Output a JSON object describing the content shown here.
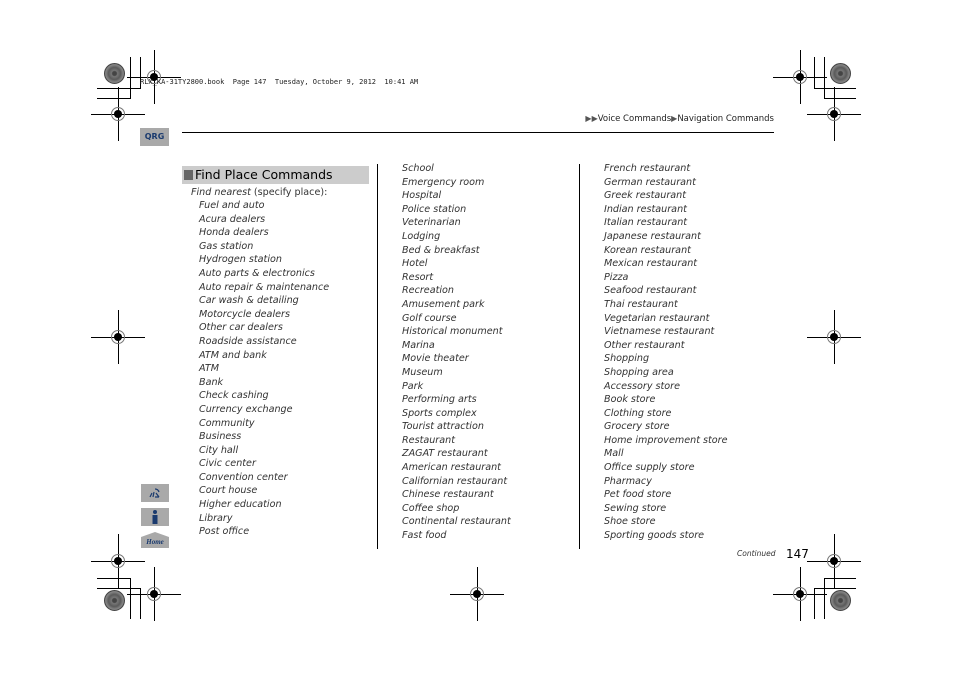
{
  "print_header": "RLX_KA-31TY2800.book  Page 147  Tuesday, October 9, 2012  10:41 AM",
  "tab_label": "QRG",
  "breadcrumb": {
    "items": [
      "Voice Commands",
      "Navigation Commands"
    ],
    "separator_icon": "triangle-right-icon"
  },
  "section": {
    "title": "Find Place Commands",
    "intro_italic": "Find nearest",
    "intro_rest": " (specify place):"
  },
  "columns": [
    {
      "items": [
        "Fuel and auto",
        "Acura dealers",
        "Honda dealers",
        "Gas station",
        "Hydrogen station",
        "Auto parts & electronics",
        "Auto repair & maintenance",
        "Car wash & detailing",
        "Motorcycle dealers",
        "Other car dealers",
        "Roadside assistance",
        "ATM and bank",
        "ATM",
        "Bank",
        "Check cashing",
        "Currency exchange",
        "Community",
        "Business",
        "City hall",
        "Civic center",
        "Convention center",
        "Court house",
        "Higher education",
        "Library",
        "Post office"
      ]
    },
    {
      "items": [
        "School",
        "Emergency room",
        "Hospital",
        "Police station",
        "Veterinarian",
        "Lodging",
        "Bed & breakfast",
        "Hotel",
        "Resort",
        "Recreation",
        "Amusement park",
        "Golf course",
        "Historical monument",
        "Marina",
        "Movie theater",
        "Museum",
        "Park",
        "Performing arts",
        "Sports complex",
        "Tourist attraction",
        "Restaurant",
        "ZAGAT restaurant",
        "American restaurant",
        "Californian restaurant",
        "Chinese restaurant",
        "Coffee shop",
        "Continental restaurant",
        "Fast food"
      ]
    },
    {
      "items": [
        "French restaurant",
        "German restaurant",
        "Greek restaurant",
        "Indian restaurant",
        "Italian restaurant",
        "Japanese restaurant",
        "Korean restaurant",
        "Mexican restaurant",
        "Pizza",
        "Seafood restaurant",
        "Thai restaurant",
        "Vegetarian restaurant",
        "Vietnamese restaurant",
        "Other restaurant",
        "Shopping",
        "Shopping area",
        "Accessory store",
        "Book store",
        "Clothing store",
        "Grocery store",
        "Home improvement store",
        "Mall",
        "Office supply store",
        "Pharmacy",
        "Pet food store",
        "Sewing store",
        "Shoe store",
        "Sporting goods store"
      ]
    }
  ],
  "side_icons": [
    {
      "name": "voice-command-icon"
    },
    {
      "name": "info-icon"
    },
    {
      "name": "home-icon",
      "label": "Home"
    }
  ],
  "footer": {
    "continued": "Continued",
    "page_number": "147"
  },
  "colors": {
    "tab_bg": "#a9a9a9",
    "tab_text": "#1a3a6e",
    "section_bg": "#cccccc",
    "section_square": "#666666"
  }
}
